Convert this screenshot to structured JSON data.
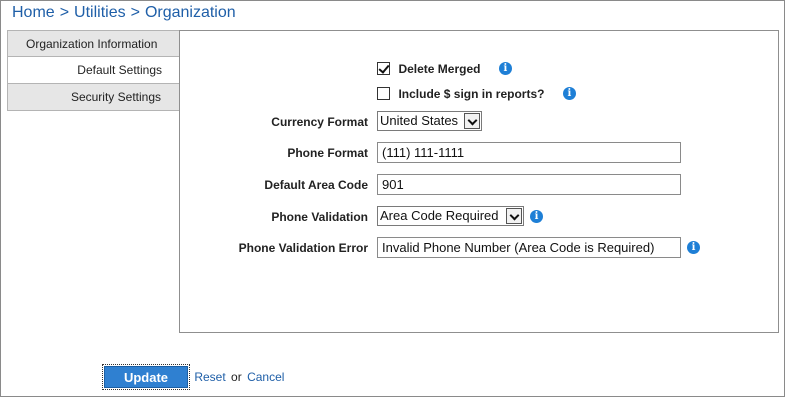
{
  "breadcrumb": {
    "items": [
      "Home",
      "Utilities",
      "Organization"
    ],
    "separator": ">"
  },
  "tabs": [
    {
      "label": "Organization Information",
      "active": false
    },
    {
      "label": "Default Settings",
      "active": true
    },
    {
      "label": "Security Settings",
      "active": false
    }
  ],
  "form": {
    "delete_merged": {
      "label": "Delete Merged",
      "checked": true,
      "info_icon": "info-icon"
    },
    "include_dollar": {
      "label": "Include $ sign in reports?",
      "checked": false,
      "info_icon": "info-icon"
    },
    "currency_format": {
      "label": "Currency Format",
      "value": "United States"
    },
    "phone_format": {
      "label": "Phone Format",
      "value": "(111) 111-1111"
    },
    "default_area_code": {
      "label": "Default Area Code",
      "value": "901"
    },
    "phone_validation": {
      "label": "Phone Validation",
      "value": "Area Code Required",
      "info_icon": "info-icon"
    },
    "phone_validation_error": {
      "label": "Phone Validation Error",
      "value": "Invalid Phone Number (Area Code is Required)",
      "info_icon": "info-icon"
    }
  },
  "footer": {
    "update_label": "Update",
    "reset_label": "Reset",
    "or_text": "or",
    "cancel_label": "Cancel"
  },
  "colors": {
    "accent": "#2f80d1",
    "link": "#1f5fa8",
    "info": "#1e7fd6"
  }
}
